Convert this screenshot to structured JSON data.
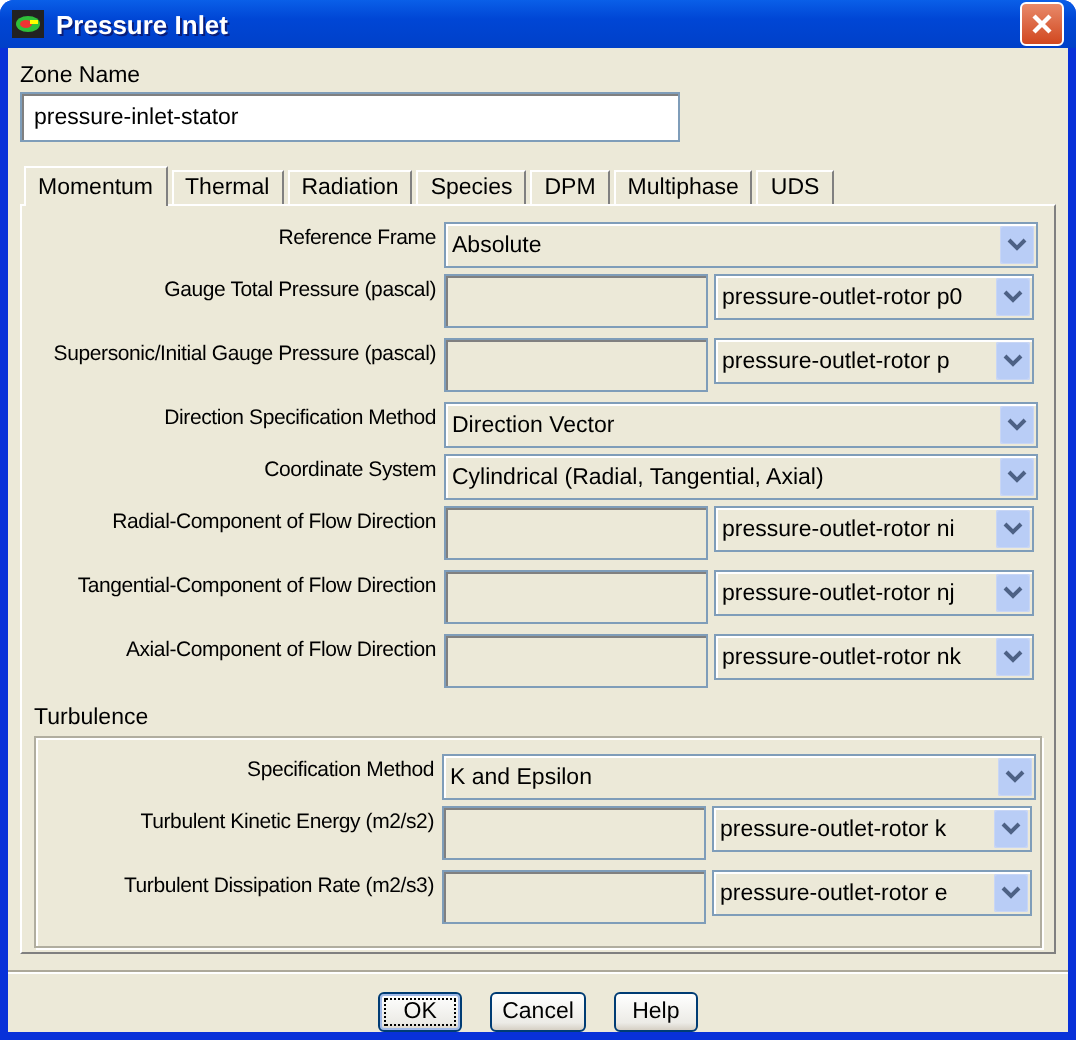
{
  "window": {
    "title": "Pressure Inlet"
  },
  "zone_name": {
    "label": "Zone Name",
    "value": "pressure-inlet-stator"
  },
  "tabs": [
    {
      "label": "Momentum",
      "selected": true
    },
    {
      "label": "Thermal",
      "selected": false
    },
    {
      "label": "Radiation",
      "selected": false
    },
    {
      "label": "Species",
      "selected": false
    },
    {
      "label": "DPM",
      "selected": false
    },
    {
      "label": "Multiphase",
      "selected": false
    },
    {
      "label": "UDS",
      "selected": false
    }
  ],
  "rows": [
    {
      "kind": "select",
      "label": "Reference Frame",
      "value": "Absolute"
    },
    {
      "kind": "field",
      "label": "Gauge Total Pressure (pascal)",
      "disabled": true,
      "profile": "pressure-outlet-rotor p0"
    },
    {
      "kind": "field",
      "label": "Supersonic/Initial Gauge Pressure (pascal)",
      "disabled": true,
      "profile": "pressure-outlet-rotor p"
    },
    {
      "kind": "select",
      "label": "Direction Specification Method",
      "value": "Direction Vector"
    },
    {
      "kind": "select",
      "label": "Coordinate System",
      "value": "Cylindrical (Radial, Tangential, Axial)"
    },
    {
      "kind": "field",
      "label": "Radial-Component of Flow Direction",
      "disabled": true,
      "profile": "pressure-outlet-rotor ni"
    },
    {
      "kind": "field",
      "label": "Tangential-Component of Flow Direction",
      "disabled": true,
      "profile": "pressure-outlet-rotor nj"
    },
    {
      "kind": "field",
      "label": "Axial-Component of Flow Direction",
      "disabled": true,
      "profile": "pressure-outlet-rotor nk"
    }
  ],
  "turbulence": {
    "title": "Turbulence",
    "rows": [
      {
        "kind": "select",
        "label": "Specification Method",
        "value": "K and Epsilon"
      },
      {
        "kind": "field",
        "label": "Turbulent Kinetic Energy (m2/s2)",
        "disabled": true,
        "profile": "pressure-outlet-rotor k"
      },
      {
        "kind": "field",
        "label": "Turbulent Dissipation Rate (m2/s3)",
        "disabled": true,
        "profile": "pressure-outlet-rotor e"
      }
    ]
  },
  "buttons": [
    {
      "label": "OK",
      "selected": true
    },
    {
      "label": "Cancel",
      "selected": false
    },
    {
      "label": "Help",
      "selected": false
    }
  ]
}
